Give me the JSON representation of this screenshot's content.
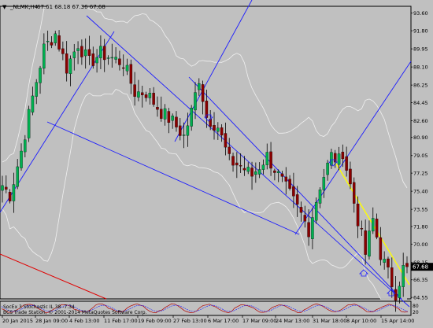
{
  "chart_header": {
    "symbol_text": "_NLMK,H4",
    "ohlc_text": "67.61 68.18 67.36 67.68"
  },
  "indicator": {
    "label": "SocEx 3 Stochastic IL 38 -7.34",
    "values": [
      "80",
      "20"
    ]
  },
  "watermark": "BCS Trade Station, © 2001-2014 MetaQuotes Software Corp.",
  "colors": {
    "background": "#c0c0c0",
    "bull_candle": "#00b050",
    "bear_candle": "#8b0000",
    "wick": "#000000",
    "trend_channel": "#1a1aff",
    "bollinger": "#f0f0f0",
    "yellow_trend": "#ffff00",
    "red_trend": "#e00000",
    "stoch_main": "#b00000",
    "stoch_signal": "#1a1aff",
    "current_price_tag": "#000000"
  },
  "chart_data": {
    "type": "candlestick",
    "symbol": "_NLMK",
    "timeframe": "H4",
    "current_price": 67.68,
    "ylim": [
      64.4,
      94.3
    ],
    "y_ticks": [
      93.6,
      91.8,
      89.95,
      88.1,
      86.25,
      84.45,
      82.6,
      80.9,
      79.05,
      77.25,
      75.4,
      73.55,
      71.8,
      70.0,
      68.15,
      66.35,
      64.55
    ],
    "x_tick_labels": [
      "20 Jan 2015",
      "28 Jan 09:00",
      "4 Feb 13:00",
      "11 Feb 17:00",
      "19 Feb 09:00",
      "27 Feb 13:00",
      "6 Mar 17:00",
      "17 Mar 09:00",
      "24 Mar 13:00",
      "31 Mar 18:00",
      "8 Apr 10:00",
      "15 Apr 14:00"
    ],
    "path": [
      [
        0,
        76.0
      ],
      [
        2,
        75.0
      ],
      [
        5,
        79.5
      ],
      [
        8,
        85.0
      ],
      [
        11,
        90.0
      ],
      [
        14,
        91.5
      ],
      [
        17,
        88.0
      ],
      [
        20,
        90.5
      ],
      [
        23,
        88.5
      ],
      [
        26,
        89.5
      ],
      [
        29,
        89.0
      ],
      [
        32,
        88.5
      ],
      [
        35,
        85.5
      ],
      [
        38,
        85.5
      ],
      [
        42,
        83.5
      ],
      [
        45,
        82.5
      ],
      [
        48,
        81.0
      ],
      [
        50,
        83.5
      ],
      [
        52,
        87.0
      ],
      [
        54,
        83.0
      ],
      [
        57,
        82.0
      ],
      [
        60,
        78.5
      ],
      [
        63,
        78.0
      ],
      [
        66,
        77.0
      ],
      [
        70,
        79.0
      ],
      [
        73,
        77.0
      ],
      [
        76,
        75.0
      ],
      [
        79,
        73.0
      ],
      [
        81,
        71.5
      ],
      [
        84,
        76.0
      ],
      [
        87,
        79.0
      ],
      [
        89,
        78.5
      ],
      [
        90,
        79.5
      ],
      [
        92,
        76.0
      ],
      [
        94,
        72.5
      ],
      [
        96,
        69.0
      ],
      [
        98,
        72.5
      ],
      [
        100,
        69.0
      ],
      [
        102,
        67.0
      ],
      [
        104,
        65.0
      ],
      [
        106,
        67.5
      ],
      [
        107,
        67.68
      ]
    ]
  }
}
